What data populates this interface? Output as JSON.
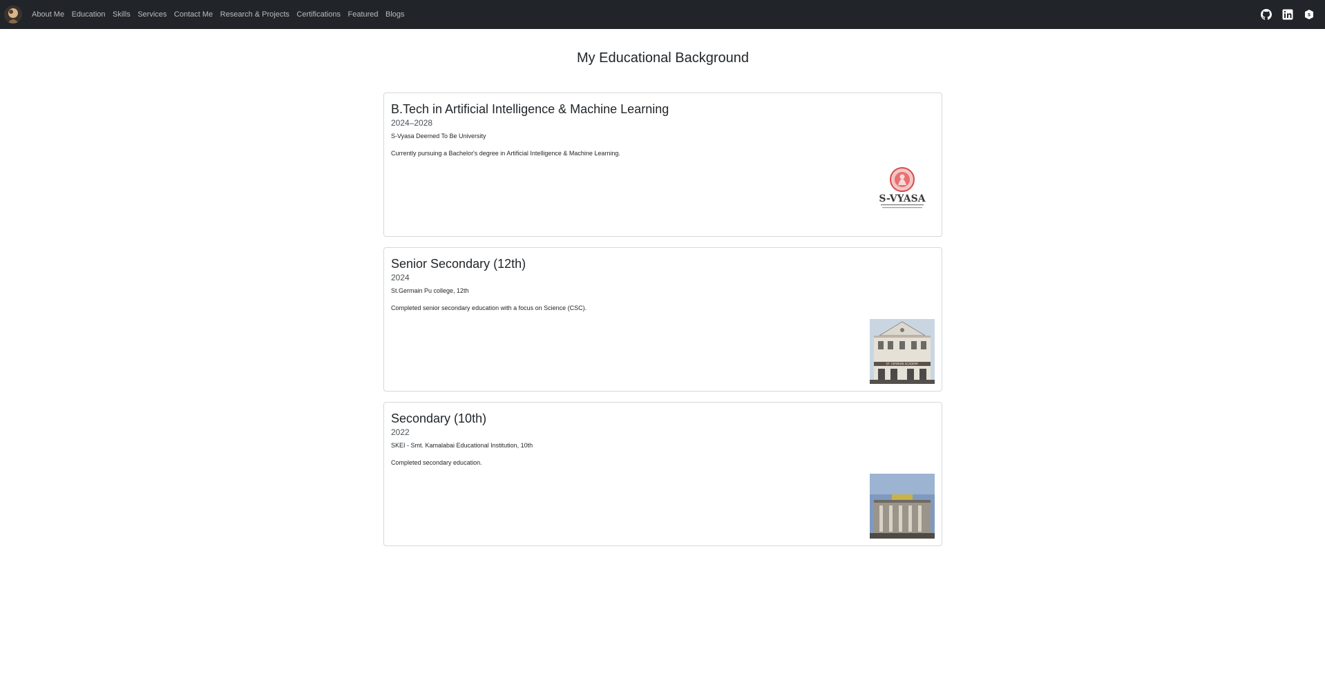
{
  "nav": {
    "links": [
      "About Me",
      "Education",
      "Skills",
      "Services",
      "Contact Me",
      "Research & Projects",
      "Certifications",
      "Featured",
      "Blogs"
    ],
    "icons": [
      "github-icon",
      "linkedin-icon",
      "shield-icon"
    ]
  },
  "page": {
    "title": "My Educational Background"
  },
  "education": [
    {
      "degree": "B.Tech in Artificial Intelligence & Machine Learning",
      "years": "2024–2028",
      "institution": "S-Vyasa Deemed To Be University",
      "description": "Currently pursuing a Bachelor's degree in Artificial Intelligence & Machine Learning.",
      "logo_text": "S-VYASA"
    },
    {
      "degree": "Senior Secondary (12th)",
      "years": "2024",
      "institution": "St.Germain Pu college, 12th",
      "description": "Completed senior secondary education with a focus on Science (CSC).",
      "photo_caption": "ST. GERMAIN ACADEMY"
    },
    {
      "degree": "Secondary (10th)",
      "years": "2022",
      "institution": "SKEI - Smt. Kamalabai Educational Institution, 10th",
      "description": "Completed secondary education."
    }
  ]
}
